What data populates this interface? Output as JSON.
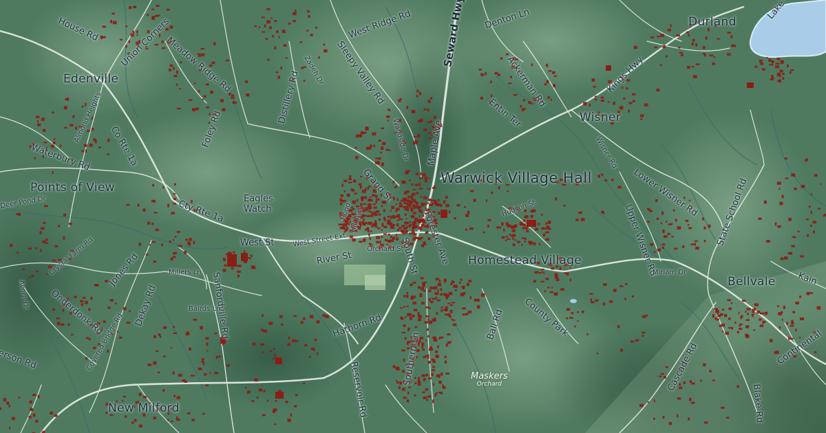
{
  "map": {
    "places": {
      "durland": "Durland",
      "edenville": "Edenville",
      "wisner": "Wisner",
      "points_of_view": "Points of View",
      "homestead_village": "Homestead Village",
      "bellvale": "Bellvale",
      "new_milford": "New Milford",
      "eagles_watch_1": "Eagles",
      "eagles_watch_2": "Watch"
    },
    "poi": {
      "warwick_village_hall": "Warwick Village Hall",
      "maskers": "Maskers",
      "orchard": "Orchard"
    },
    "roads": {
      "seward_hwy": "Seward Hwy",
      "west_ridge_rd": "West Ridge Rd",
      "denton_ln": "Denton Ln",
      "lake_ave": "Lake Ave",
      "house_rd": "House Rd",
      "union_corners": "Union Corners",
      "meadow_ridge_rd": "Meadow Ridge Rd",
      "sleepy_valley_rd": "Sleepy Valley Rd",
      "zadeh_dr": "Zadeh Dr",
      "ackerman_rd": "Ackerman Rd",
      "kings_hwy": "Kings Hwy",
      "distillery_rd": "Distillery Rd",
      "foley_rd": "Foley Rd",
      "co_rte_1a": "Co Rte 1a",
      "almond_heights": "Almond Heights",
      "waterbury_rd": "Waterbury Rd",
      "entin_ter": "Entin Ter",
      "maple_ave": "Maple Ave",
      "woodside_dr": "Woodside Dr",
      "grand_st": "Grand St",
      "wisner_rd": "Wisner Rd",
      "lower_wisner_rd": "Lower Wisner Rd",
      "state_school_rd": "State School Rd",
      "cty_rte_1a": "Cty Rte 1a",
      "bond_st": "Bond",
      "hill_ave": "Hill Ave",
      "hudson_st": "Hudson St",
      "upper_wisner_rd": "Upper Wisner Rd",
      "west_st": "West St",
      "west_street_ext": "West Street Ext",
      "orchard_st": "Orchard St",
      "forester_ave": "Forester Ave",
      "river_st": "River St",
      "south_st": "South St",
      "crystal_farm_rd": "Crystal Farm Rd",
      "jones_rd": "Jones Rd",
      "millers_ln": "Millers Ln",
      "dekay_rd": "Dekay Rd",
      "sanfordville_rd": "Sanfordville Rd",
      "onderdonk_rd": "Onderdonk Rd",
      "bairds_ln": "Bairds Ln",
      "hathorn_rd": "Hathorn Rd",
      "county_park": "County Park",
      "ball_rd": "Ball Rd",
      "miriam_dr": "Miriam Dr",
      "kain_rd": "Kain",
      "southern_ln": "Southern Ln",
      "reservoir_rd": "Reservoir Rd",
      "cascade_rd": "Cascade Rd",
      "blake_rd": "Blake Rd",
      "continental": "Continental",
      "covered_bridge_rd": "Covered Bridge Rd",
      "acorn_dr": "Acorn Dr",
      "deer_pond_dr": "Deer Pond Dr",
      "overson_rd": "erson Rd"
    },
    "colors": {
      "terrain": "#4f7a60",
      "building": "#8a1e16",
      "road": "#e7ece5",
      "water": "#a9cde8",
      "stream": "#3a6b6e",
      "label": "#1d2e3d"
    }
  }
}
